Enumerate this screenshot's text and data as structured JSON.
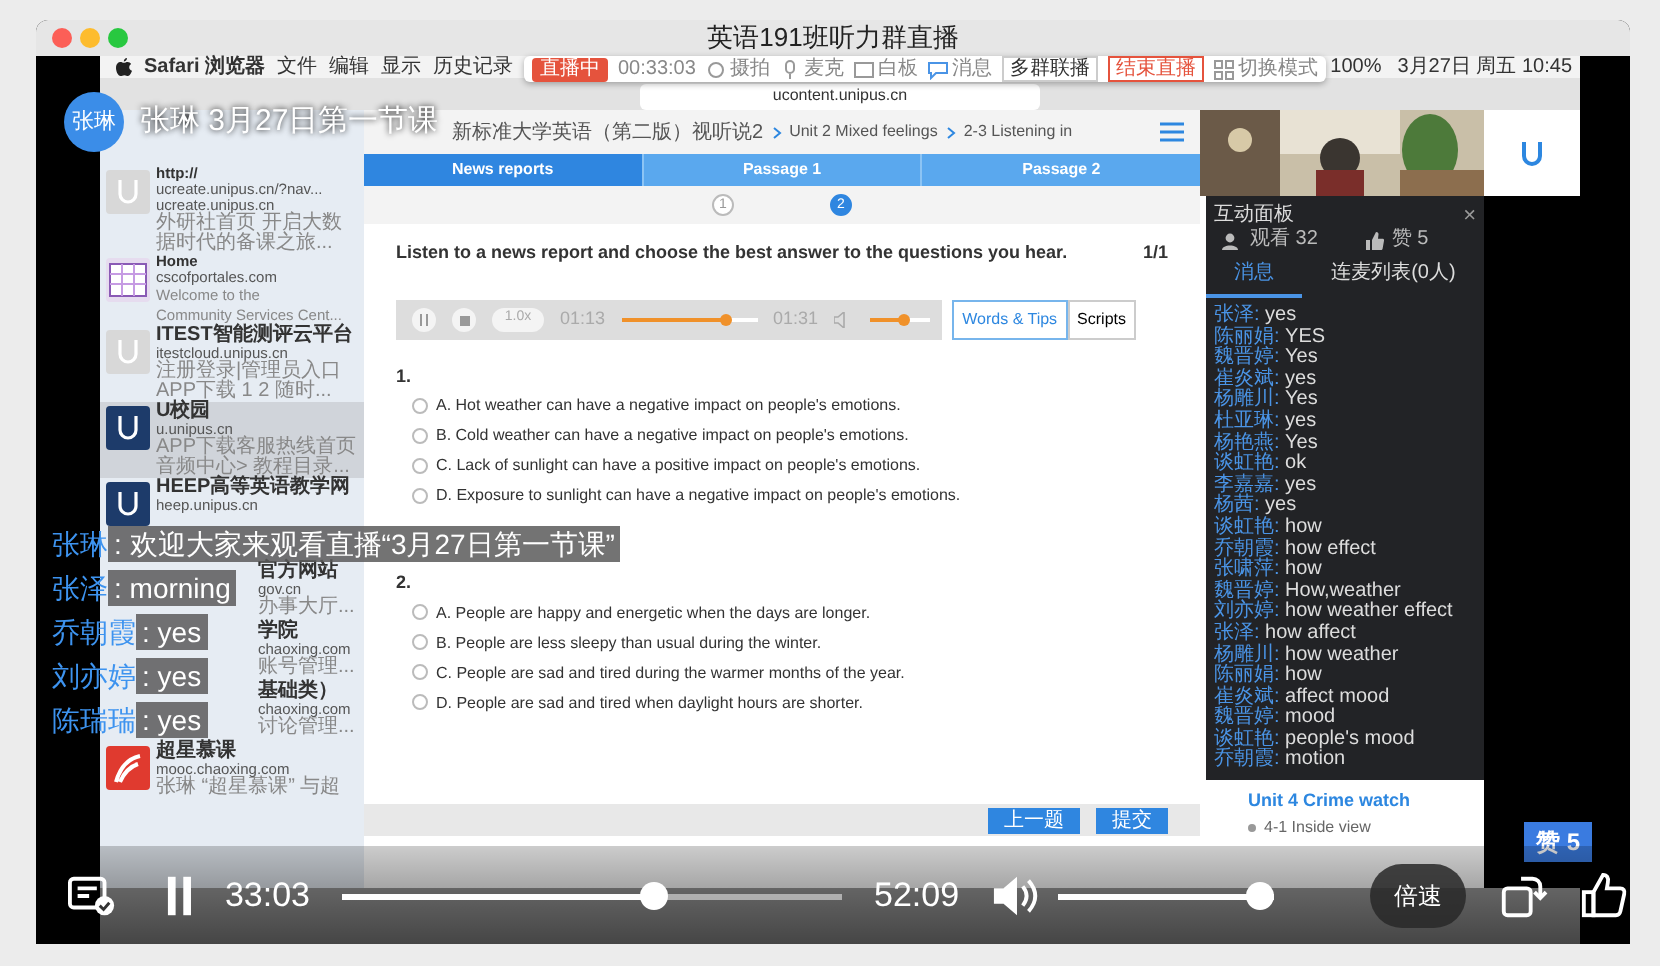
{
  "window": {
    "title": "英语191班听力群直播"
  },
  "host": {
    "avatar": "张琳",
    "title": "张琳 3月27日第一节课"
  },
  "mac_menu": {
    "items": [
      "Safari 浏览器",
      "文件",
      "编辑",
      "显示",
      "历史记录"
    ],
    "status": [
      "100%",
      "3月27日 周五 10:45"
    ]
  },
  "live_toolbar": {
    "badge": "直播中",
    "time": "00:33:03",
    "tools": [
      "摄拍",
      "麦克",
      "白板",
      "消息"
    ],
    "buttons": [
      {
        "label": "多群联播",
        "kind": "plain"
      },
      {
        "label": "结束直播",
        "kind": "danger"
      }
    ],
    "mode": "切换模式"
  },
  "address": "ucontent.unipus.cn",
  "history": [
    {
      "kind": "light",
      "selected": false,
      "lines": [
        "http://",
        "ucreate.unipus.cn/?nav...",
        "ucreate.unipus.cn"
      ],
      "desc": [
        "外研社首页 开启大数",
        "据时代的备课之旅..."
      ]
    },
    {
      "kind": "calendar",
      "selected": false,
      "lines": [
        "Home",
        "cscofportales.com"
      ],
      "desc": [
        "Welcome to the",
        "Community Services Cent..."
      ]
    },
    {
      "kind": "light",
      "selected": false,
      "lines": [
        "ITEST智能测评云平台",
        "itestcloud.unipus.cn"
      ],
      "desc": [
        "注册登录|管理员入口",
        "APP下载 1 2 随时..."
      ]
    },
    {
      "kind": "dark",
      "selected": true,
      "lines": [
        "U校园",
        "u.unipus.cn"
      ],
      "desc": [
        "APP下载客服热线首页",
        "音频中心> 教程目录..."
      ]
    },
    {
      "kind": "dark",
      "selected": false,
      "lines": [
        "HEEP高等英语教学网",
        "heep.unipus.cn"
      ]
    },
    {
      "kind": "blank",
      "selected": false,
      "lines": [
        "官方网站",
        "gov.cn"
      ],
      "desc": [
        "办事大厅..."
      ]
    },
    {
      "kind": "blank",
      "selected": false,
      "lines": [
        "学院",
        "chaoxing.com"
      ],
      "desc": [
        "账号管理..."
      ]
    },
    {
      "kind": "blank",
      "selected": false,
      "lines": [
        "基础类）",
        "chaoxing.com"
      ],
      "desc": [
        "讨论管理..."
      ]
    },
    {
      "kind": "mooc",
      "selected": false,
      "lines": [
        "超星慕课",
        "mooc.chaoxing.com"
      ],
      "desc": [
        "张琳 “超星慕课” 与超"
      ]
    }
  ],
  "lesson": {
    "breadcrumb": [
      "新标准大学英语（第二版）视听说2",
      "Unit 2 Mixed feelings",
      "2-3 Listening in"
    ],
    "tabs": [
      {
        "label": "News reports",
        "selected": true
      },
      {
        "label": "Passage 1",
        "selected": false
      },
      {
        "label": "Passage 2",
        "selected": false
      }
    ],
    "steps": [
      {
        "label": "1",
        "selected": false
      },
      {
        "label": "2",
        "selected": true
      }
    ],
    "instruction": "Listen to a news report and choose the best answer to the questions you hear.",
    "page": "1/1",
    "audio": {
      "speed": "1.0x",
      "elapsed": "01:13",
      "total": "01:31",
      "level": 0.8,
      "volume": {
        "level": 0.6
      }
    },
    "resources": [
      {
        "label": "Words & Tips",
        "selected": true
      },
      {
        "label": "Scripts",
        "selected": false
      }
    ],
    "questions": [
      {
        "number": "1.",
        "options": [
          {
            "label": "A. Hot weather can have a negative impact on people's emotions.",
            "selected": false
          },
          {
            "label": "B. Cold weather can have a negative impact on people's emotions.",
            "selected": false
          },
          {
            "label": "C. Lack of sunlight can have a positive impact on people's emotions.",
            "selected": false
          },
          {
            "label": "D. Exposure to sunlight can have a negative impact on people's emotions.",
            "selected": false
          }
        ]
      },
      {
        "number": "2.",
        "options": [
          {
            "label": "A. People are happy and energetic when the days are longer.",
            "selected": false
          },
          {
            "label": "B. People are less sleepy than usual during the winter.",
            "selected": false
          },
          {
            "label": "C. People are sad and tired during the warmer months of the year.",
            "selected": false
          },
          {
            "label": "D. People are sad and tired when daylight hours are shorter.",
            "selected": false
          }
        ]
      }
    ],
    "footer_buttons": [
      "上一题",
      "提交"
    ]
  },
  "panel": {
    "title": "互动面板",
    "close": "×",
    "viewers": "观看 32",
    "likes": "赞 5",
    "tabs": [
      {
        "label": "消息",
        "selected": true
      },
      {
        "label": "连麦列表(0人)",
        "selected": false
      }
    ],
    "messages": [
      {
        "name": "张泽:",
        "text": "yes"
      },
      {
        "name": "陈丽娟:",
        "text": "YES"
      },
      {
        "name": "魏晋婷:",
        "text": "Yes"
      },
      {
        "name": "崔炎斌:",
        "text": "yes"
      },
      {
        "name": "杨雕川:",
        "text": "Yes"
      },
      {
        "name": "杜亚琳:",
        "text": "yes"
      },
      {
        "name": "杨艳燕:",
        "text": "Yes"
      },
      {
        "name": "谈虹艳:",
        "text": "ok"
      },
      {
        "name": "李嘉嘉:",
        "text": "yes"
      },
      {
        "name": "杨茜:",
        "text": "yes"
      },
      {
        "name": "谈虹艳:",
        "text": "how"
      },
      {
        "name": "乔朝霞:",
        "text": "how effect"
      },
      {
        "name": "张啸萍:",
        "text": "how"
      },
      {
        "name": "魏晋婷:",
        "text": "How,weather"
      },
      {
        "name": "刘亦婷:",
        "text": "how weather effect"
      },
      {
        "name": "张泽:",
        "text": "how affect"
      },
      {
        "name": "杨雕川:",
        "text": "how weather"
      },
      {
        "name": "陈丽娟:",
        "text": "how"
      },
      {
        "name": "崔炎斌:",
        "text": "affect mood"
      },
      {
        "name": "魏晋婷:",
        "text": "mood"
      },
      {
        "name": "谈虹艳:",
        "text": "people's mood"
      },
      {
        "name": "乔朝霞:",
        "text": "motion"
      }
    ]
  },
  "course_outline": [
    "Unit 4 Crime watch",
    "4-1 Inside view"
  ],
  "like_badge": "赞 5",
  "comments": [
    {
      "name": "张琳",
      "text": ": 欢迎大家来观看直播“3月27日第一节课”"
    },
    {
      "name": "张泽",
      "text": ": morning"
    },
    {
      "name": "乔朝霞",
      "text": ": yes"
    },
    {
      "name": "刘亦婷",
      "text": ": yes"
    },
    {
      "name": "陈瑞瑞",
      "text": ": yes"
    }
  ],
  "player": {
    "elapsed": "33:03",
    "total": "52:09",
    "playing": true,
    "level": 0.63,
    "volume": {
      "level": 1.0
    },
    "speed_button": "倍速"
  }
}
